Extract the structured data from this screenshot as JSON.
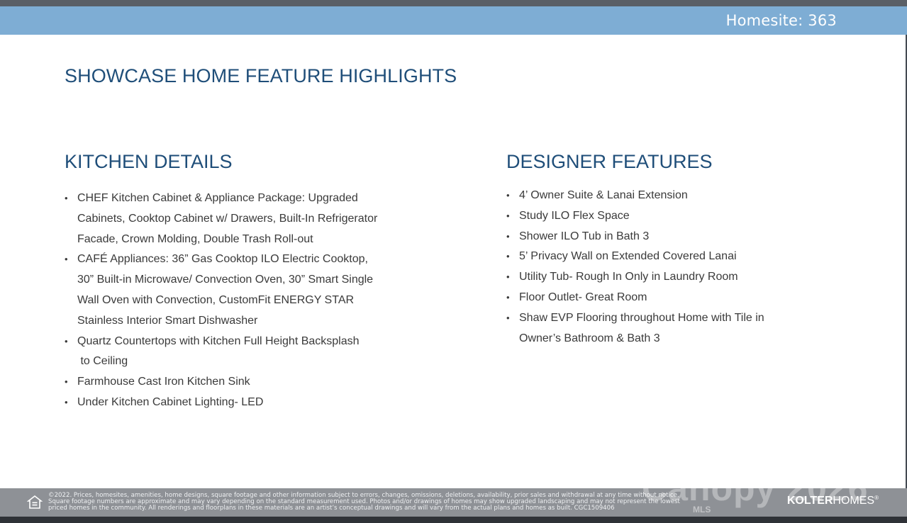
{
  "header": {
    "homesite": "Homesite: 363"
  },
  "title": "SHOWCASE HOME FEATURE HIGHLIGHTS",
  "kitchen": {
    "heading": "KITCHEN DETAILS",
    "items": [
      [
        "CHEF Kitchen Cabinet & Appliance Package: Upgraded",
        "Cabinets, Cooktop Cabinet w/ Drawers, Built-In Refrigerator",
        "Facade, Crown Molding, Double Trash Roll-out"
      ],
      [
        "CAFÉ Appliances: 36” Gas Cooktop ILO Electric Cooktop,",
        "30” Built-in Microwave/ Convection Oven, 30” Smart Single",
        "Wall Oven with Convection, CustomFit ENERGY STAR",
        "Stainless Interior Smart Dishwasher"
      ],
      [
        "Quartz Countertops with Kitchen Full Height Backsplash",
        " to Ceiling"
      ],
      [
        "Farmhouse Cast Iron Kitchen Sink"
      ],
      [
        "Under Kitchen Cabinet Lighting- LED"
      ]
    ]
  },
  "designer": {
    "heading": "DESIGNER FEATURES",
    "items": [
      [
        "4’ Owner Suite & Lanai Extension"
      ],
      [
        "Study ILO Flex Space"
      ],
      [
        "Shower ILO Tub in Bath 3"
      ],
      [
        "5’ Privacy Wall on Extended Covered Lanai"
      ],
      [
        "Utility Tub- Rough In Only in Laundry Room"
      ],
      [
        "Floor Outlet- Great Room"
      ],
      [
        "Shaw EVP Flooring throughout Home with Tile in",
        "Owner’s Bathroom & Bath 3"
      ]
    ]
  },
  "footer": {
    "disclaimer_lines": [
      "©2022. Prices, homesites, amenities, home designs, square footage and other information subject to errors, changes, omissions, deletions, availability, prior sales and withdrawal at any time without notice.",
      "Square footage numbers are approximate and may vary depending on the standard measurement used. Photos and/or drawings of homes may show upgraded landscaping and may not represent the lowest",
      "priced homes in the community. All renderings and floorplans in these materials are an artist’s conceptual drawings and will vary from the actual plans and homes as built. CGC1509406"
    ],
    "watermark": "Canopy 2026",
    "watermark_sub": "MLS",
    "logo_bold": "KOLTER",
    "logo_light": "HOMES",
    "logo_mark": "®"
  },
  "icons": {
    "footer_icon": "equal-housing-icon"
  }
}
